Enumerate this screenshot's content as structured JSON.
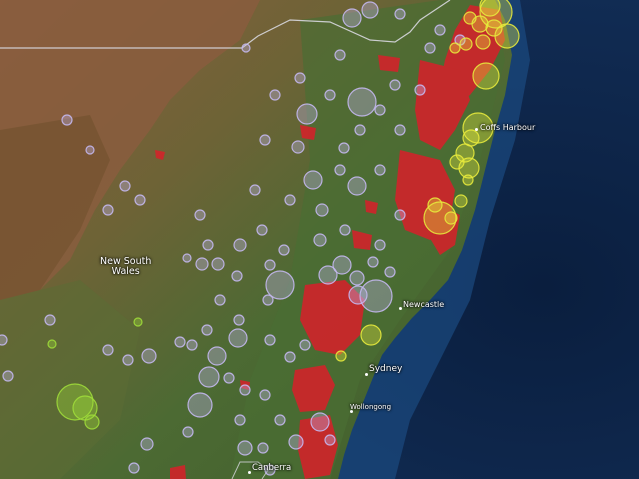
{
  "map": {
    "colors": {
      "ocean": "#0c2346",
      "land_green": "#4d6a33",
      "land_brown": "#7a5a3c",
      "fire_red": "#d4222a",
      "recent_yellow": "#e7ea3c",
      "older_purple": "#c4b8f0",
      "green_marker": "#9edc3a",
      "border": "#d8d8e0"
    },
    "labels": {
      "state_line1": "New South",
      "state_line2": "Wales",
      "coffs": "Coffs Harbour",
      "newcastle": "Newcastle",
      "sydney": "Sydney",
      "wollongong": "Wollongong",
      "canberra": "Canberra"
    },
    "layers": [
      "fire-burn-areas",
      "hotspot-markers",
      "state-border"
    ]
  }
}
